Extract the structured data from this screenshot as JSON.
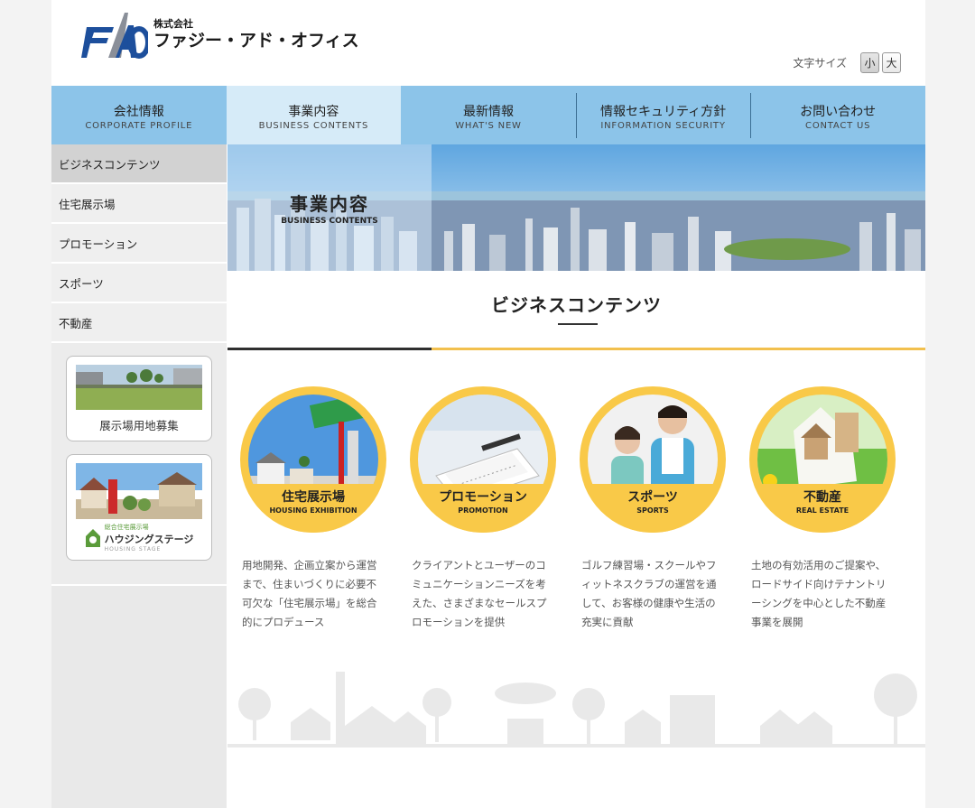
{
  "header": {
    "company_prefix": "株式会社",
    "company_name": "ファジー・アド・オフィス",
    "logo_mark": "FAO",
    "fontsize_label": "文字サイズ",
    "fontsize_small": "小",
    "fontsize_large": "大"
  },
  "nav": {
    "items": [
      {
        "jp": "会社情報",
        "en": "CORPORATE  PROFILE"
      },
      {
        "jp": "事業内容",
        "en": "BUSINESS CONTENTS"
      },
      {
        "jp": "最新情報",
        "en": "WHAT'S NEW"
      },
      {
        "jp": "情報セキュリティ方針",
        "en": "INFORMATION SECURITY"
      },
      {
        "jp": "お問い合わせ",
        "en": "CONTACT US"
      }
    ]
  },
  "sidebar": {
    "items": [
      {
        "label": "ビジネスコンテンツ"
      },
      {
        "label": "住宅展示場"
      },
      {
        "label": "プロモーション"
      },
      {
        "label": "スポーツ"
      },
      {
        "label": "不動産"
      }
    ],
    "banner1_label": "展示場用地募集",
    "banner2_sub": "総合住宅展示場",
    "banner2_main": "ハウジングステージ",
    "banner2_en": "HOUSING STAGE"
  },
  "hero": {
    "title_jp": "事業内容",
    "title_en": "BUSINESS CONTENTS"
  },
  "main": {
    "section_title": "ビジネスコンテンツ",
    "cards": [
      {
        "jp": "住宅展示場",
        "en": "HOUSING EXHIBITION",
        "text": "用地開発、企画立案から運営まで、住まいづくりに必要不可欠な「住宅展示場」を総合的にプロデュース"
      },
      {
        "jp": "プロモーション",
        "en": "PROMOTION",
        "text": "クライアントとユーザーのコミュニケーションニーズを考えた、さまざまなセールスプロモーションを提供"
      },
      {
        "jp": "スポーツ",
        "en": "SPORTS",
        "text": "ゴルフ練習場・スクールやフィットネスクラブの運営を通して、お客様の健康や生活の充実に貢献"
      },
      {
        "jp": "不動産",
        "en": "REAL ESTATE",
        "text": "土地の有効活用のご提案や、ロードサイド向けテナントリーシングを中心とした不動産事業を展開"
      }
    ]
  },
  "colors": {
    "nav": "#8cc4e9",
    "nav_active": "#d6ebf8",
    "accent_yellow": "#f9c948",
    "logo_blue": "#1d4f9c"
  }
}
